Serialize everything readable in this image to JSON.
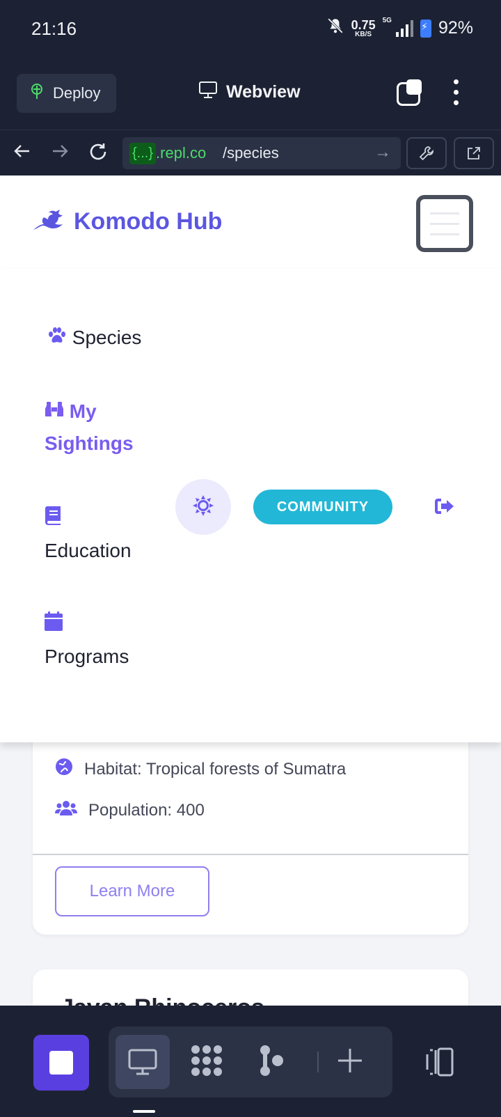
{
  "status_bar": {
    "time": "21:16",
    "net_speed_value": "0.75",
    "net_speed_unit": "KB/S",
    "network": "5G",
    "battery": "92%"
  },
  "replit_header": {
    "deploy_label": "Deploy",
    "webview_label": "Webview"
  },
  "url_bar": {
    "host_tag": "{...}",
    "host": ".repl.co",
    "path": "/species"
  },
  "site": {
    "brand": "Komodo Hub",
    "menu": [
      {
        "label": "Species",
        "icon": "paw-icon",
        "active": false
      },
      {
        "label": "My Sightings",
        "line1": "My",
        "line2": "Sightings",
        "icon": "binoculars-icon",
        "active": true
      },
      {
        "label": "Education",
        "icon": "book-icon",
        "active": false
      },
      {
        "label": "Programs",
        "icon": "calendar-icon",
        "active": false
      }
    ],
    "community_label": "COMMUNITY"
  },
  "species_card": {
    "habitat": "Habitat: Tropical forests of Sumatra",
    "population": "Population: 400",
    "learn_more": "Learn More"
  },
  "next_card": {
    "title": "Javan Rhinoceros"
  },
  "colors": {
    "brand": "#5b56e0",
    "active_menu": "#7a5cf0",
    "community": "#22b7d6",
    "stop_button": "#5a3fe0",
    "chrome_bg": "#1c2233"
  }
}
